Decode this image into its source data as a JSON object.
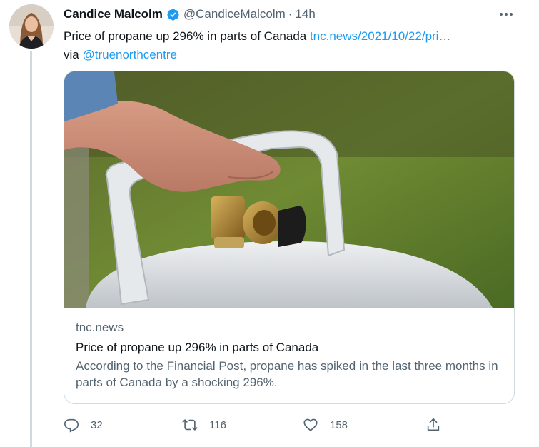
{
  "tweet": {
    "author_name": "Candice Malcolm",
    "handle": "@CandiceMalcolm",
    "separator": "·",
    "time": "14h",
    "text_before": "Price of propane up 296% in parts of Canada ",
    "link": "tnc.news/2021/10/22/pri…",
    "via_prefix": "via ",
    "mention": "@truenorthcentre"
  },
  "card": {
    "domain": "tnc.news",
    "title": "Price of propane up 296% in parts of Canada",
    "description": "According to the Financial Post, propane has spiked in the last three months in parts of Canada by a shocking 296%."
  },
  "actions": {
    "replies": "32",
    "retweets": "116",
    "likes": "158"
  },
  "icons": {
    "avatar": "profile-photo",
    "verified": "verified-badge-icon",
    "more": "more-icon",
    "reply": "reply-icon",
    "retweet": "retweet-icon",
    "like": "heart-icon",
    "share": "share-icon"
  },
  "colors": {
    "link": "#1d9bf0",
    "secondary_text": "#536471",
    "primary_text": "#0f1419",
    "border": "#cfd9de"
  }
}
